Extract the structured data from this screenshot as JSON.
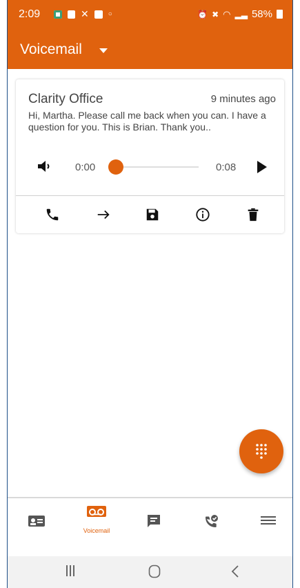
{
  "status_bar": {
    "time": "2:09",
    "battery": "58%",
    "bg": "#e0620e"
  },
  "app_bar": {
    "title": "Voicemail"
  },
  "voicemail": {
    "from": "Clarity Office",
    "time_ago": "9 minutes ago",
    "transcript": "Hi, Martha. Please call me back when you can. I have a question for you. This is Brian. Thank you..",
    "position": "0:00",
    "duration": "0:08",
    "progress_fraction": 0
  },
  "card_actions": [
    "call-back-icon",
    "forward-arrow-icon",
    "save-disk-icon",
    "info-icon",
    "delete-trash-icon"
  ],
  "bottom_nav": {
    "items": [
      {
        "name": "contacts",
        "icon": "contact-card-icon",
        "label": ""
      },
      {
        "name": "voicemail",
        "icon": "voicemail-icon",
        "label": "Voicemail",
        "active": true
      },
      {
        "name": "messages",
        "icon": "chat-message-icon",
        "label": ""
      },
      {
        "name": "call-history",
        "icon": "phone-check-icon",
        "label": ""
      },
      {
        "name": "menu",
        "icon": "hamburger-menu-icon",
        "label": ""
      }
    ]
  },
  "colors": {
    "accent": "#e0620e",
    "text": "#444444",
    "icon": "#111111",
    "inactive_icon": "#555555"
  }
}
